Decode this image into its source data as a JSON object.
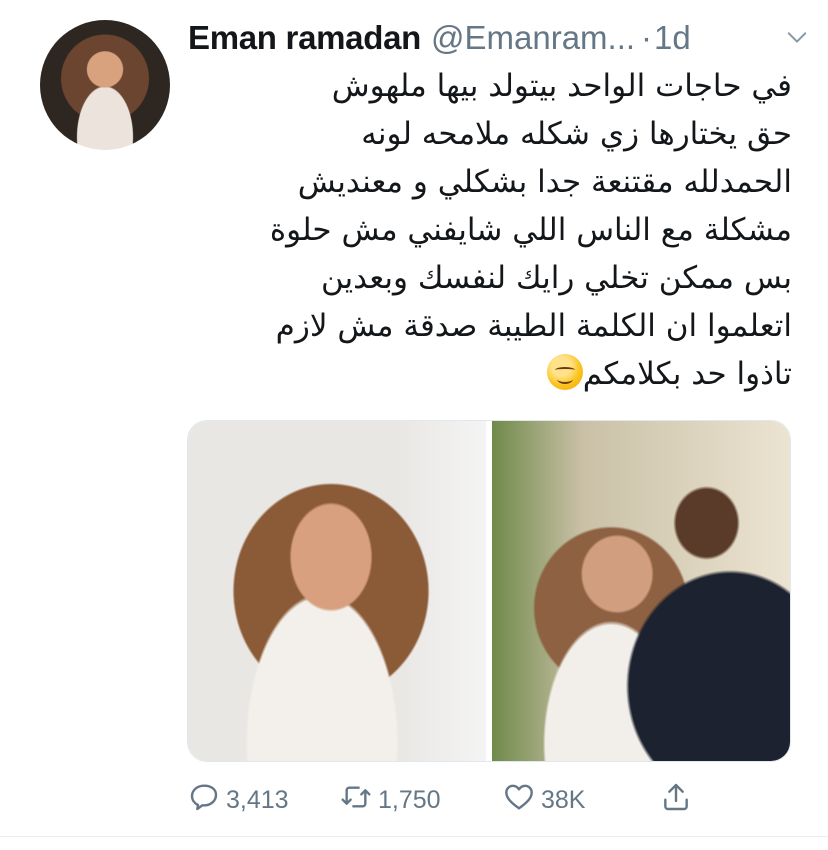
{
  "tweet": {
    "display_name": "Eman ramadan",
    "handle": "@Emanram...",
    "separator": "·",
    "timestamp": "1d",
    "text_lines": [
      "في حاجات الواحد بيتولد بيها ملهوش",
      "حق يختارها زي شكله ملامحه لونه",
      "الحمدلله مقتنعة جدا بشكلي و معنديش",
      "مشكلة مع الناس اللي شايفني مش حلوة",
      "بس ممكن تخلي رايك لنفسك وبعدين",
      "اتعلموا ان الكلمة الطيبة صدقة مش لازم",
      "تاذوا حد بكلامكم"
    ],
    "emoji": "smiling-face-emoji"
  },
  "actions": {
    "replies": "3,413",
    "retweets": "1,750",
    "likes": "38K"
  },
  "icons": {
    "chevron": "chevron-down-icon",
    "reply": "reply-icon",
    "retweet": "retweet-icon",
    "like": "heart-icon",
    "share": "share-icon"
  },
  "colors": {
    "text": "#14171a",
    "secondary": "#657786",
    "border": "#e6ecf0"
  }
}
